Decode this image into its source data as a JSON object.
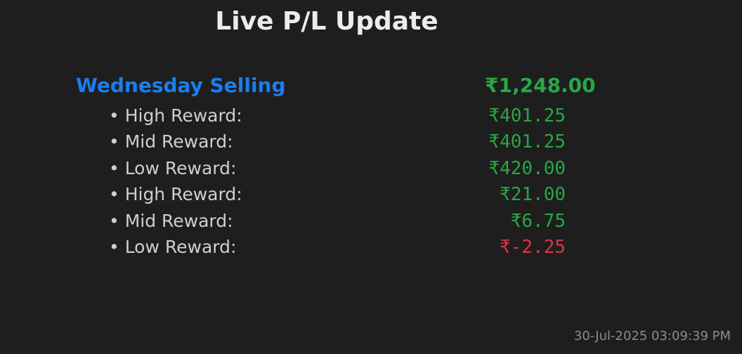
{
  "header": {
    "title": "Live P/L Update"
  },
  "strategy": {
    "name": "Wednesday Selling",
    "total": "₹1,248.00",
    "total_color": "#28a745",
    "legs": [
      {
        "label": "• High Reward:",
        "value": "₹401.25",
        "color": "#28a745"
      },
      {
        "label": "• Mid Reward:",
        "value": "₹401.25",
        "color": "#28a745"
      },
      {
        "label": "• Low Reward:",
        "value": "₹420.00",
        "color": "#28a745"
      },
      {
        "label": "• High Reward:",
        "value": "₹21.00",
        "color": "#28a745"
      },
      {
        "label": "• Mid Reward:",
        "value": "₹6.75",
        "color": "#28a745"
      },
      {
        "label": "• Low Reward:",
        "value": "₹-2.25",
        "color": "#dc3545"
      }
    ]
  },
  "footer": {
    "timestamp": "30-Jul-2025 03:09:39 PM"
  },
  "colors": {
    "background": "#1e1e1e",
    "title": "#ececec",
    "strategy_name": "#1a7ef0",
    "label": "#cfcfcf",
    "profit": "#28a745",
    "loss": "#dc3545",
    "timestamp": "#8c8c8c"
  }
}
